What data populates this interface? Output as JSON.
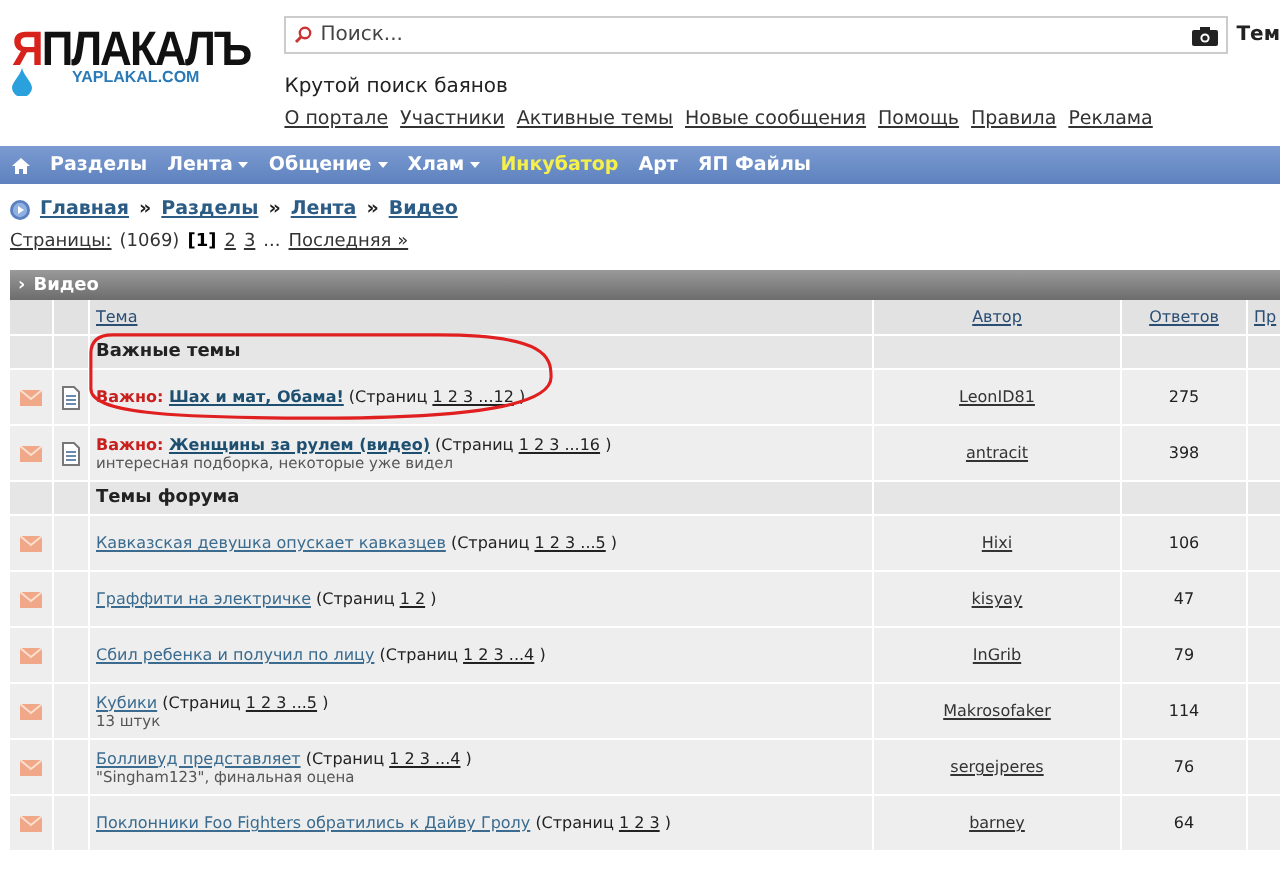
{
  "logo": {
    "title": "ЯПЛАКАЛЪ",
    "domain": "YAPLAKAL.COM"
  },
  "search": {
    "placeholder": "Поиск...",
    "scope": "Тем"
  },
  "tagline": "Крутой поиск баянов",
  "top_links": [
    "О портале",
    "Участники",
    "Активные темы",
    "Новые сообщения",
    "Помощь",
    "Правила",
    "Реклама"
  ],
  "nav": [
    {
      "label": "Разделы",
      "dropdown": false,
      "highlighted": false
    },
    {
      "label": "Лента",
      "dropdown": true,
      "highlighted": false
    },
    {
      "label": "Общение",
      "dropdown": true,
      "highlighted": false
    },
    {
      "label": "Хлам",
      "dropdown": true,
      "highlighted": false
    },
    {
      "label": "Инкубатор",
      "dropdown": false,
      "highlighted": true
    },
    {
      "label": "Арт",
      "dropdown": false,
      "highlighted": false
    },
    {
      "label": "ЯП Файлы",
      "dropdown": false,
      "highlighted": false
    }
  ],
  "breadcrumb": {
    "items": [
      "Главная",
      "Разделы",
      "Лента",
      "Видео"
    ],
    "separator": "»"
  },
  "pagination": [
    {
      "kind": "link",
      "text": "Страницы:"
    },
    {
      "kind": "plain",
      "text": "(1069)"
    },
    {
      "kind": "current",
      "text": "[1]"
    },
    {
      "kind": "link",
      "text": "2"
    },
    {
      "kind": "link",
      "text": "3"
    },
    {
      "kind": "plain",
      "text": "..."
    },
    {
      "kind": "link",
      "text": "Последняя »"
    }
  ],
  "forum": {
    "title_marker": "›",
    "title": "Видео",
    "columns": [
      "Тема",
      "Автор",
      "Ответов",
      "Пр"
    ],
    "sections": [
      {
        "heading": "Важные темы",
        "rows": [
          {
            "pinned": true,
            "label": "Важно:",
            "title": "Шах и мат, Обама!",
            "pages_prefix": "(Страниц",
            "pages": "1 2 3 ...12",
            "pages_suffix": ")",
            "author": "LeonID81",
            "replies": "275"
          },
          {
            "pinned": true,
            "label": "Важно:",
            "title": "Женщины за рулем (видео)",
            "pages_prefix": "(Страниц",
            "pages": "1 2 3 ...16",
            "pages_suffix": ")",
            "description": "интересная подборка, некоторые уже видел",
            "author": "antracit",
            "replies": "398"
          }
        ]
      },
      {
        "heading": "Темы форума",
        "rows": [
          {
            "pinned": false,
            "title": "Кавказская девушка опускает кавказцев",
            "pages_prefix": "(Страниц",
            "pages": "1 2 3 ...5",
            "pages_suffix": ")",
            "author": "Hixi",
            "replies": "106"
          },
          {
            "pinned": false,
            "title": "Граффити на электричке",
            "pages_prefix": "(Страниц",
            "pages": "1 2",
            "pages_suffix": ")",
            "author": "kisyay",
            "replies": "47"
          },
          {
            "pinned": false,
            "title": "Сбил ребенка и получил по лицу",
            "pages_prefix": "(Страниц",
            "pages": "1 2 3 ...4",
            "pages_suffix": ")",
            "author": "InGrib",
            "replies": "79"
          },
          {
            "pinned": false,
            "title": "Кубики",
            "pages_prefix": "(Страниц",
            "pages": "1 2 3 ...5",
            "pages_suffix": ")",
            "description": "13 штук",
            "author": "Makrosofaker",
            "replies": "114"
          },
          {
            "pinned": false,
            "title": "Болливуд представляет",
            "pages_prefix": "(Страниц",
            "pages": "1 2 3 ...4",
            "pages_suffix": ")",
            "description": "\"Singham123\", финальная оцена",
            "author": "sergejperes",
            "replies": "76"
          },
          {
            "pinned": false,
            "title": "Поклонники Foo Fighters обратились к Дайву Гролу",
            "pages_prefix": "(Страниц",
            "pages": "1 2 3",
            "pages_suffix": ")",
            "author": "barney",
            "replies": "64"
          }
        ]
      }
    ]
  }
}
